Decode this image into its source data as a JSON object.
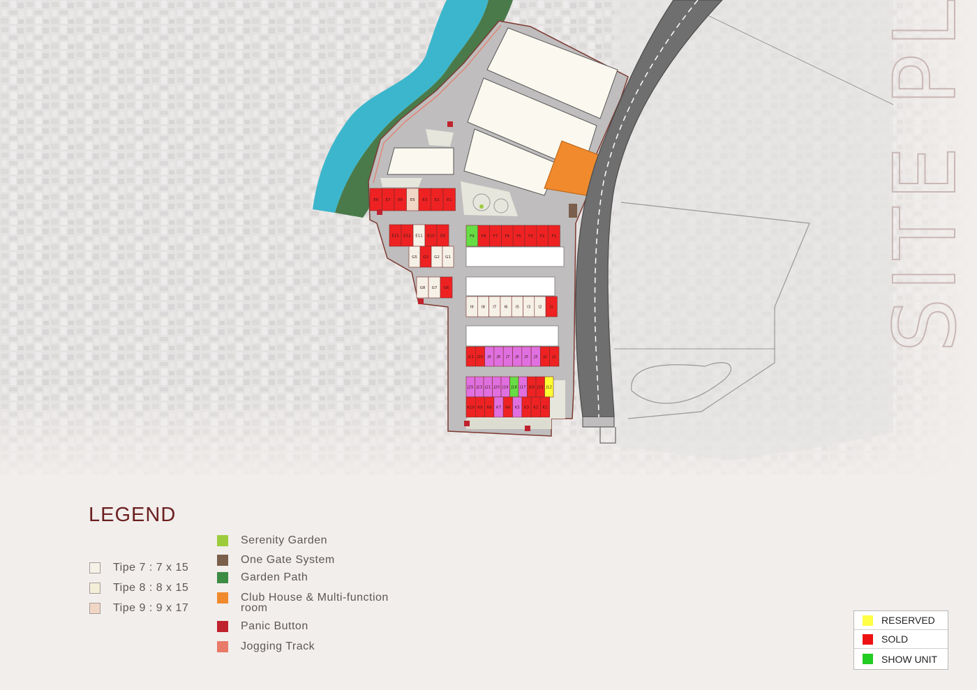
{
  "site_title": "SITE PLAN",
  "lots": {
    "row_e_top": [
      "E8",
      "E7",
      "E6",
      "E5",
      "E3",
      "E2",
      "E1"
    ],
    "row_e_mid": [
      "E15",
      "E12",
      "E11",
      "E10",
      "E9"
    ],
    "row_g_top": [
      "G5",
      "G3",
      "G2",
      "G1"
    ],
    "row_g_bot": [
      "G8",
      "G7",
      "G6"
    ],
    "row_f": [
      "F9",
      "F8",
      "F7",
      "F6",
      "F5",
      "F3",
      "F2",
      "F1"
    ],
    "row_i": [
      "I9",
      "I8",
      "I7",
      "I6",
      "I5",
      "I3",
      "I2",
      "I1"
    ],
    "row_j_top": [
      "J11",
      "J10",
      "J9",
      "J8",
      "J7",
      "J6",
      "J5",
      "J3",
      "J2",
      "J1"
    ],
    "row_j_bot": [
      "J25",
      "J23",
      "J21",
      "J20",
      "J19",
      "J18",
      "J17",
      "J16",
      "J15",
      "J12"
    ],
    "row_k": [
      "K10",
      "K9",
      "K8",
      "K7",
      "K6",
      "K5",
      "K3",
      "K2",
      "K1"
    ]
  },
  "legend": {
    "title": "LEGEND",
    "types": [
      {
        "label": "Tipe 7 : 7 x 15",
        "color": "#f6f1e7"
      },
      {
        "label": "Tipe 8 : 8 x 15",
        "color": "#f2eed8"
      },
      {
        "label": "Tipe 9 : 9 x 17",
        "color": "#f1d6c6"
      }
    ],
    "facilities": [
      {
        "label": "Serenity Garden",
        "color": "#9ccc3c"
      },
      {
        "label": "One Gate System",
        "color": "#7a5f4c"
      },
      {
        "label": "Garden Path",
        "color": "#3c8c44"
      },
      {
        "label": "Club House & Multi-function room",
        "color": "#f08a2c"
      },
      {
        "label": "Panic Button",
        "color": "#c0222d"
      },
      {
        "label": "Jogging Track",
        "color": "#e87a68"
      }
    ]
  },
  "status": [
    {
      "label": "RESERVED",
      "color": "#ffff44"
    },
    {
      "label": "SOLD",
      "color": "#ee1111"
    },
    {
      "label": "SHOW UNIT",
      "color": "#22cc22"
    }
  ]
}
